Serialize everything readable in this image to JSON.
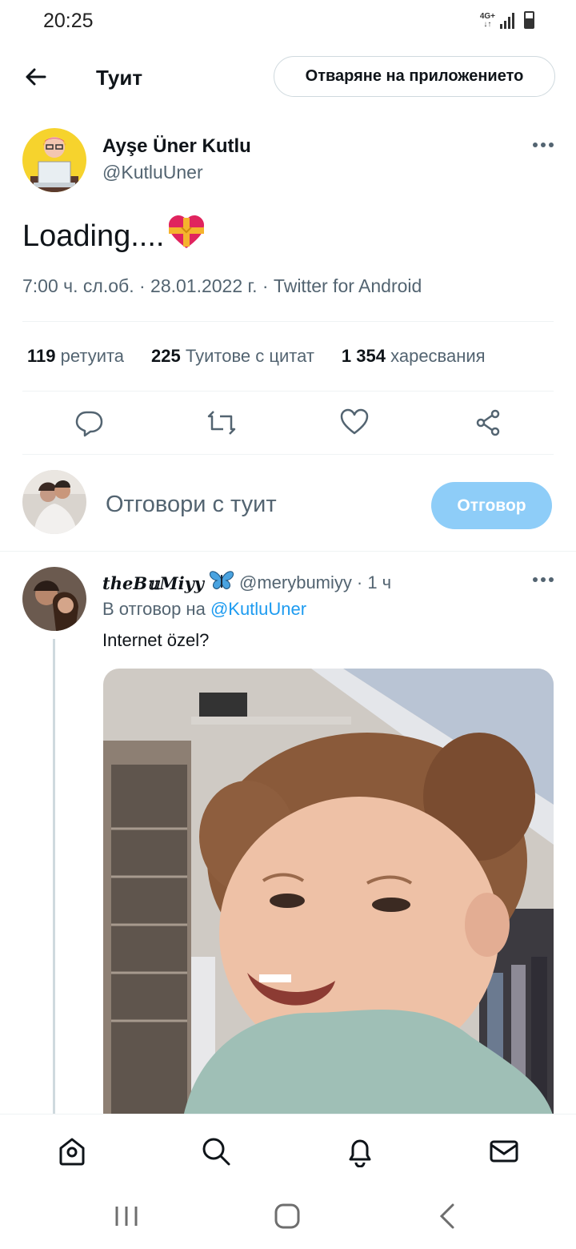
{
  "status_bar": {
    "time": "20:25",
    "network": "4G+"
  },
  "header": {
    "title": "Туит",
    "open_app_label": "Отваряне на приложението"
  },
  "tweet": {
    "author_name": "Ayşe Üner Kutlu",
    "author_handle": "@KutluUner",
    "text": "Loading....",
    "emoji": "heart-with-ribbon",
    "meta": "7:00 ч. сл.об. · 28.01.2022 г. · Twitter for Android",
    "stats": {
      "retweets_count": "119",
      "retweets_label": "ретуита",
      "quotes_count": "225",
      "quotes_label": "Туитове с цитат",
      "likes_count": "1 354",
      "likes_label": "харесвания"
    }
  },
  "composer": {
    "placeholder": "Отговори с туит",
    "reply_button": "Отговор"
  },
  "reply": {
    "name": "theB𝕦Miyy",
    "handle": "@merybumiyy",
    "time": "· 1 ч",
    "reply_to_label": "В отговор на",
    "reply_to_handle": "@KutluUner",
    "text": "Internet özel?"
  },
  "colors": {
    "accent": "#1d9bf0",
    "reply_button_bg": "#8ecdf8",
    "secondary_text": "#536471"
  },
  "bottom_nav": [
    "home-icon",
    "search-icon",
    "notifications-icon",
    "messages-icon"
  ],
  "system_nav": [
    "recents-icon",
    "home-circle-icon",
    "back-chevron-icon"
  ]
}
